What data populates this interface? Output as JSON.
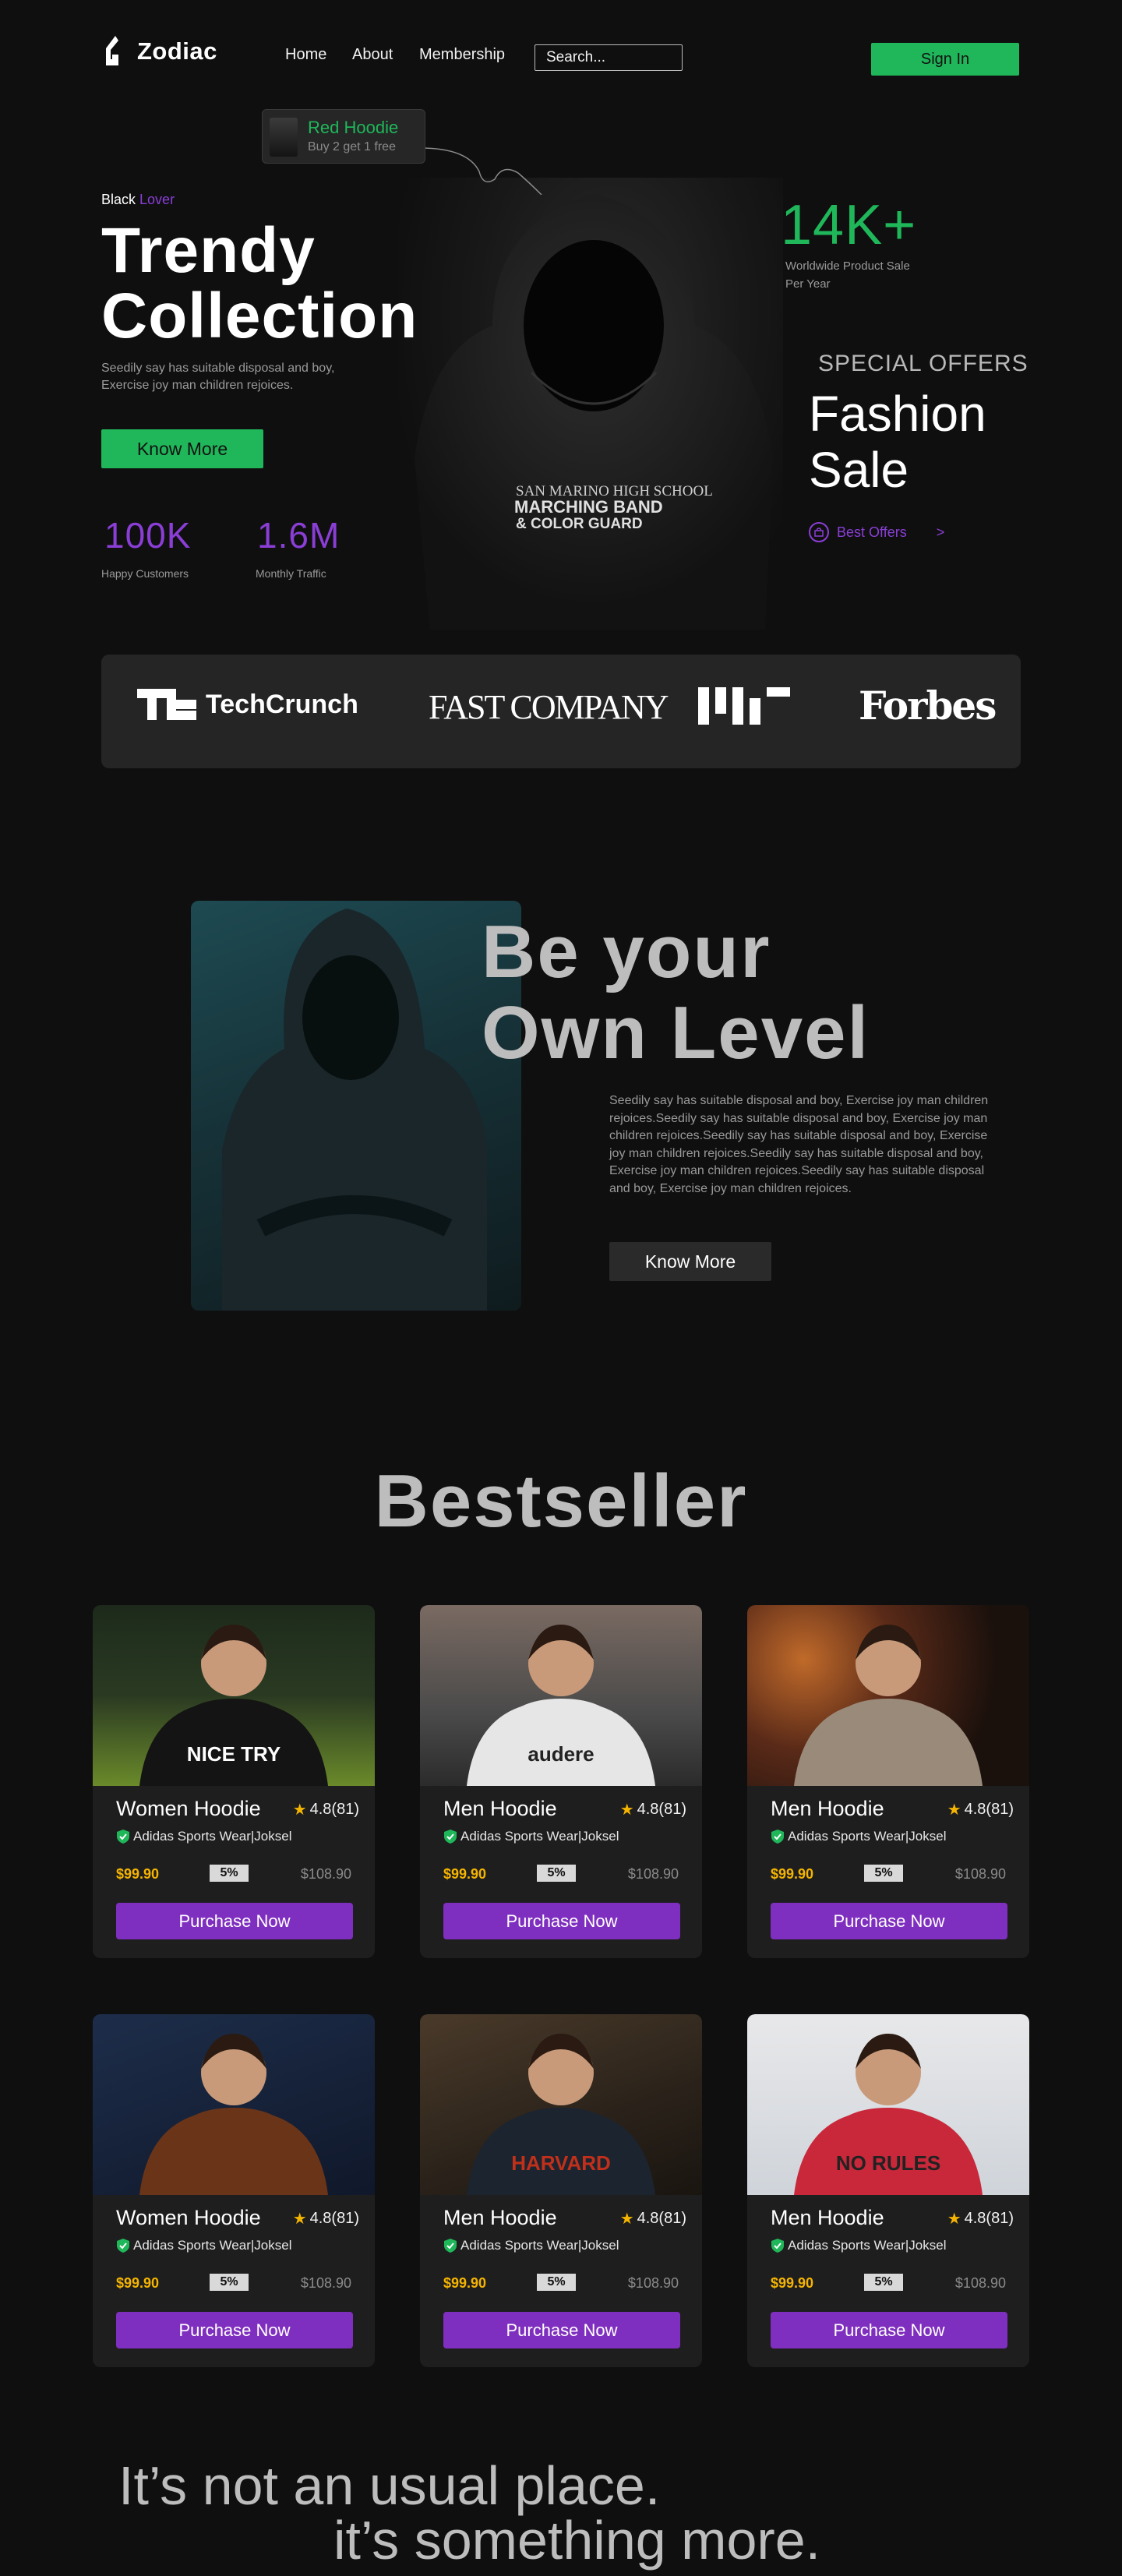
{
  "nav": {
    "brand": "Zodiac",
    "links": [
      "Home",
      "About",
      "Membership"
    ],
    "search_placeholder": "Search...",
    "signin": "Sign In"
  },
  "hero": {
    "tooltip_title": "Red Hoodie",
    "tooltip_sub": "Buy 2 get 1 free",
    "kicker_a": "Black",
    "kicker_b": "Lover",
    "title_line1": "Trendy",
    "title_line2": "Collection",
    "description": "Seedily say has suitable disposal and boy, Exercise joy man children rejoices.",
    "cta": "Know More",
    "stats": [
      {
        "value": "100K",
        "label": "Happy Customers"
      },
      {
        "value": "1.6M",
        "label": "Monthly Traffic"
      }
    ],
    "big_stat": "14K+",
    "big_stat_label": "Worldwide Product Sale Per Year",
    "special": "SPECIAL OFFERS",
    "fashion_line1": "Fashion",
    "fashion_line2": "Sale",
    "best_offers": "Best Offers",
    "arrow": ">",
    "shirt_line1": "SAN MARINO HIGH SCHOOL",
    "shirt_line2": "MARCHING BAND",
    "shirt_line3": "& COLOR GUARD"
  },
  "brands": {
    "techcrunch": "TechCrunch",
    "fastcompany": "FAST COMPANY",
    "forbes": "Forbes"
  },
  "level": {
    "title_line1": "Be your",
    "title_line2": "Own Level",
    "description": "Seedily say has suitable disposal and boy, Exercise joy man children rejoices.Seedily say has suitable disposal and boy, Exercise joy man children rejoices.Seedily say has suitable disposal and boy, Exercise joy man children rejoices.Seedily say has suitable disposal and boy, Exercise joy man children rejoices.Seedily say has suitable disposal and boy, Exercise joy man children rejoices.",
    "cta": "Know More"
  },
  "bestseller": {
    "title": "Bestseller",
    "products": [
      {
        "name": "Women Hoodie",
        "rating": "4.8(81)",
        "brand": "Adidas Sports Wear|Joksel",
        "price": "$99.90",
        "discount": "5%",
        "old_price": "$108.90",
        "cta": "Purchase Now",
        "shirt_text": "NICE TRY"
      },
      {
        "name": "Men Hoodie",
        "rating": "4.8(81)",
        "brand": "Adidas Sports Wear|Joksel",
        "price": "$99.90",
        "discount": "5%",
        "old_price": "$108.90",
        "cta": "Purchase Now",
        "shirt_text": "audere"
      },
      {
        "name": "Men Hoodie",
        "rating": "4.8(81)",
        "brand": "Adidas Sports Wear|Joksel",
        "price": "$99.90",
        "discount": "5%",
        "old_price": "$108.90",
        "cta": "Purchase Now",
        "shirt_text": ""
      },
      {
        "name": "Women Hoodie",
        "rating": "4.8(81)",
        "brand": "Adidas Sports Wear|Joksel",
        "price": "$99.90",
        "discount": "5%",
        "old_price": "$108.90",
        "cta": "Purchase Now",
        "shirt_text": ""
      },
      {
        "name": "Men Hoodie",
        "rating": "4.8(81)",
        "brand": "Adidas Sports Wear|Joksel",
        "price": "$99.90",
        "discount": "5%",
        "old_price": "$108.90",
        "cta": "Purchase Now",
        "shirt_text": "HARVARD"
      },
      {
        "name": "Men Hoodie",
        "rating": "4.8(81)",
        "brand": "Adidas Sports Wear|Joksel",
        "price": "$99.90",
        "discount": "5%",
        "old_price": "$108.90",
        "cta": "Purchase Now",
        "shirt_text": "NO RULES"
      }
    ]
  },
  "slogan": {
    "line1": "It’s not an usual place.",
    "line2": "it’s something more."
  },
  "colors": {
    "green": "#1fb75a",
    "purple": "#8a3ed6",
    "button_purple": "#7f2fbf",
    "gold": "#f5b400",
    "background": "#0f0f0f"
  }
}
